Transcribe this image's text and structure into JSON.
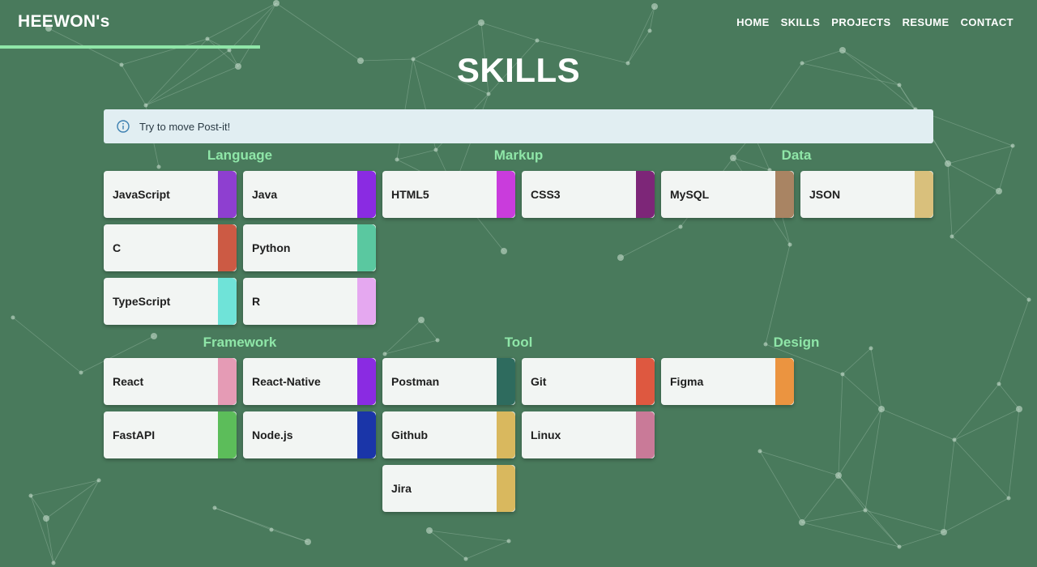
{
  "header": {
    "logo": "HEEWON's",
    "nav": [
      "HOME",
      "SKILLS",
      "PROJECTS",
      "RESUME",
      "CONTACT"
    ]
  },
  "page_title": "SKILLS",
  "info": {
    "text": "Try to move Post-it!",
    "icon": "info-circle-icon"
  },
  "categories": [
    {
      "title": "Language",
      "items": [
        {
          "label": "JavaScript",
          "color": "#8e3fd0"
        },
        {
          "label": "Java",
          "color": "#8a2be2"
        },
        {
          "label": "C",
          "color": "#cc5a44"
        },
        {
          "label": "Python",
          "color": "#5ac8a0"
        },
        {
          "label": "TypeScript",
          "color": "#6fe3d8"
        },
        {
          "label": "R",
          "color": "#e5a8f0"
        }
      ]
    },
    {
      "title": "Markup",
      "items": [
        {
          "label": "HTML5",
          "color": "#c93cdc"
        },
        {
          "label": "CSS3",
          "color": "#7d2678"
        }
      ]
    },
    {
      "title": "Data",
      "items": [
        {
          "label": "MySQL",
          "color": "#a98463"
        },
        {
          "label": "JSON",
          "color": "#d9c07c"
        }
      ]
    },
    {
      "title": "Framework",
      "items": [
        {
          "label": "React",
          "color": "#e59bb5"
        },
        {
          "label": "React-Native",
          "color": "#8a2be2"
        },
        {
          "label": "FastAPI",
          "color": "#5cbd5a"
        },
        {
          "label": "Node.js",
          "color": "#1a35a8"
        }
      ]
    },
    {
      "title": "Tool",
      "items": [
        {
          "label": "Postman",
          "color": "#2e6b5e"
        },
        {
          "label": "Git",
          "color": "#de5840"
        },
        {
          "label": "Github",
          "color": "#d9b85e"
        },
        {
          "label": "Linux",
          "color": "#c97a98"
        },
        {
          "label": "Jira",
          "color": "#d9b85e"
        }
      ]
    },
    {
      "title": "Design",
      "items": [
        {
          "label": "Figma",
          "color": "#eb9440"
        }
      ]
    }
  ]
}
